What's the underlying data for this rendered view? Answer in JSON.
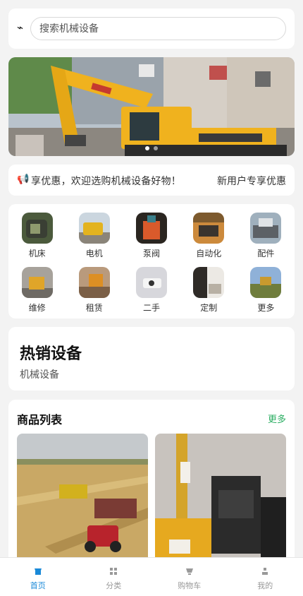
{
  "search": {
    "logo_glyph": "⌁",
    "placeholder": "搜索机械设备"
  },
  "banner": {
    "dot_count": 2,
    "active_dot": 0
  },
  "notice": {
    "speaker_glyph": "📢",
    "text": "享优惠，欢迎选购机械设备好物！",
    "right_text": "新用户专享优惠"
  },
  "categories": [
    {
      "label": "机床",
      "icon": "lathe-icon"
    },
    {
      "label": "电机",
      "icon": "motor-icon"
    },
    {
      "label": "泵阀",
      "icon": "pump-valve-icon"
    },
    {
      "label": "自动化",
      "icon": "automation-icon"
    },
    {
      "label": "配件",
      "icon": "parts-icon"
    },
    {
      "label": "维修",
      "icon": "repair-icon"
    },
    {
      "label": "租赁",
      "icon": "rental-icon"
    },
    {
      "label": "二手",
      "icon": "second-hand-icon"
    },
    {
      "label": "定制",
      "icon": "custom-icon"
    },
    {
      "label": "更多",
      "icon": "more-icon"
    }
  ],
  "hot": {
    "title": "热销设备",
    "subtitle": "机械设备"
  },
  "products": {
    "title": "商品列表",
    "more": "更多"
  },
  "tabs": [
    {
      "label": "首页",
      "icon": "home-icon",
      "active": true
    },
    {
      "label": "分类",
      "icon": "category-icon",
      "active": false
    },
    {
      "label": "购物车",
      "icon": "cart-icon",
      "active": false
    },
    {
      "label": "我的",
      "icon": "profile-icon",
      "active": false
    }
  ],
  "colors": {
    "accent_blue": "#1989d8",
    "more_green": "#2cae63",
    "excavator_yellow": "#f0b21e"
  }
}
